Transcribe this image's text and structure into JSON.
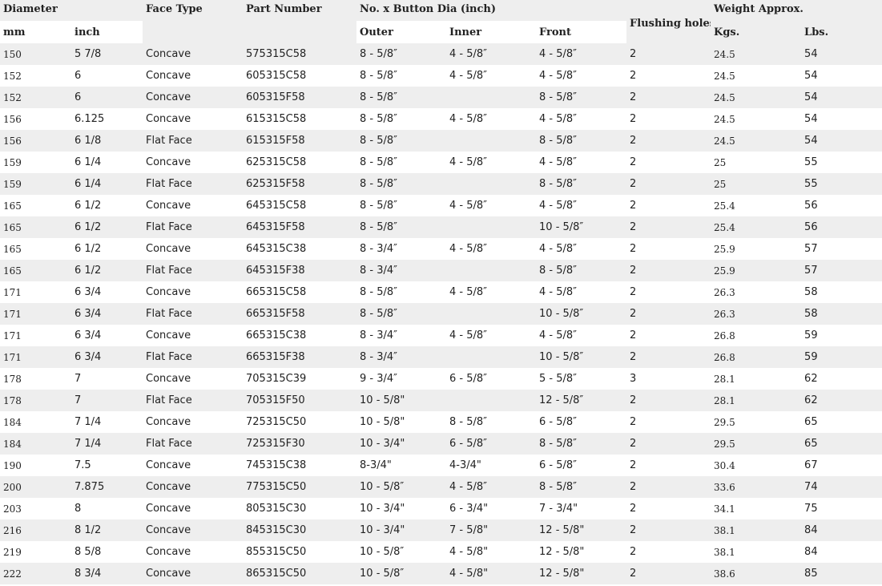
{
  "header": {
    "diameter": "Diameter",
    "face_type": "Face Type",
    "part_number": "Part Number",
    "button_dia": "No. x Button Dia (inch)",
    "flushing_holes": "Flushing holes",
    "weight": "Weight Approx.",
    "mm": "mm",
    "inch": "inch",
    "outer": "Outer",
    "inner": "Inner",
    "front": "Front",
    "kgs": "Kgs.",
    "lbs": "Lbs."
  },
  "rows": [
    [
      "150",
      "5 7/8",
      "Concave",
      "575315C58",
      "8 - 5/8″",
      "4 - 5/8″",
      "4 - 5/8″",
      "2",
      "24.5",
      "54"
    ],
    [
      "152",
      "6",
      "Concave",
      "605315C58",
      "8 - 5/8″",
      "4 - 5/8″",
      "4 - 5/8″",
      "2",
      "24.5",
      "54"
    ],
    [
      "152",
      "6",
      "Concave",
      "605315F58",
      "8 - 5/8″",
      "",
      "8 - 5/8″",
      "2",
      "24.5",
      "54"
    ],
    [
      "156",
      "6.125",
      "Concave",
      "615315C58",
      "8 - 5/8″",
      "4 - 5/8″",
      "4 - 5/8″",
      "2",
      "24.5",
      "54"
    ],
    [
      "156",
      "6 1/8",
      "Flat Face",
      "615315F58",
      "8 - 5/8″",
      "",
      "8 - 5/8″",
      "2",
      "24.5",
      "54"
    ],
    [
      "159",
      "6 1/4",
      "Concave",
      "625315C58",
      "8 - 5/8″",
      "4 - 5/8″",
      "4 - 5/8″",
      "2",
      "25",
      "55"
    ],
    [
      "159",
      "6 1/4",
      "Flat Face",
      "625315F58",
      "8 - 5/8″",
      "",
      "8 - 5/8″",
      "2",
      "25",
      "55"
    ],
    [
      "165",
      "6 1/2",
      "Concave",
      "645315C58",
      "8 - 5/8″",
      "4 - 5/8″",
      "4 - 5/8″",
      "2",
      "25.4",
      "56"
    ],
    [
      "165",
      "6 1/2",
      "Flat Face",
      "645315F58",
      "8 - 5/8″",
      "",
      "10 - 5/8″",
      "2",
      "25.4",
      "56"
    ],
    [
      "165",
      "6 1/2",
      "Concave",
      "645315C38",
      "8 - 3/4″",
      "4 - 5/8″",
      "4 - 5/8″",
      "2",
      "25.9",
      "57"
    ],
    [
      "165",
      "6 1/2",
      "Flat Face",
      "645315F38",
      "8 - 3/4″",
      "",
      "8 - 5/8″",
      "2",
      "25.9",
      "57"
    ],
    [
      "171",
      "6 3/4",
      "Concave",
      "665315C58",
      "8 - 5/8″",
      "4 - 5/8″",
      "4 - 5/8″",
      "2",
      "26.3",
      "58"
    ],
    [
      "171",
      "6 3/4",
      "Flat Face",
      "665315F58",
      "8 - 5/8″",
      "",
      "10 - 5/8″",
      "2",
      "26.3",
      "58"
    ],
    [
      "171",
      "6 3/4",
      "Concave",
      "665315C38",
      "8 - 3/4″",
      "4 - 5/8″",
      "4 - 5/8″",
      "2",
      "26.8",
      "59"
    ],
    [
      "171",
      "6 3/4",
      "Flat Face",
      "665315F38",
      "8 - 3/4″",
      "",
      "10 - 5/8″",
      "2",
      "26.8",
      "59"
    ],
    [
      "178",
      "7",
      "Concave",
      "705315C39",
      "9 - 3/4″",
      "6 - 5/8″",
      "5 - 5/8″",
      "3",
      "28.1",
      "62"
    ],
    [
      "178",
      "7",
      "Flat Face",
      "705315F50",
      "10 - 5/8\"",
      "",
      "12 - 5/8″",
      "2",
      "28.1",
      "62"
    ],
    [
      "184",
      "7 1/4",
      "Concave",
      "725315C50",
      "10 - 5/8\"",
      "8 - 5/8″",
      "6 - 5/8″",
      "2",
      "29.5",
      "65"
    ],
    [
      "184",
      "7 1/4",
      "Flat Face",
      "725315F30",
      "10 - 3/4\"",
      "6 - 5/8″",
      "8 - 5/8″",
      "2",
      "29.5",
      "65"
    ],
    [
      "190",
      "7.5",
      "Concave",
      "745315C38",
      "8-3/4\"",
      "4-3/4\"",
      "6 - 5/8″",
      "2",
      "30.4",
      "67"
    ],
    [
      "200",
      "7.875",
      "Concave",
      "775315C50",
      "10 - 5/8″",
      "4 - 5/8″",
      "8 - 5/8″",
      "2",
      "33.6",
      "74"
    ],
    [
      "203",
      "8",
      "Concave",
      "805315C30",
      "10 - 3/4\"",
      "6 - 3/4\"",
      "7 - 3/4\"",
      "2",
      "34.1",
      "75"
    ],
    [
      "216",
      "8 1/2",
      "Concave",
      "845315C30",
      "10 - 3/4\"",
      "7 - 5/8\"",
      "12 - 5/8\"",
      "2",
      "38.1",
      "84"
    ],
    [
      "219",
      "8 5/8",
      "Concave",
      "855315C50",
      "10 - 5/8″",
      "4 - 5/8\"",
      "12 - 5/8\"",
      "2",
      "38.1",
      "84"
    ],
    [
      "222",
      "8 3/4",
      "Concave",
      "865315C50",
      "10 - 5/8″",
      "4 - 5/8\"",
      "12 - 5/8\"",
      "2",
      "38.6",
      "85"
    ]
  ]
}
